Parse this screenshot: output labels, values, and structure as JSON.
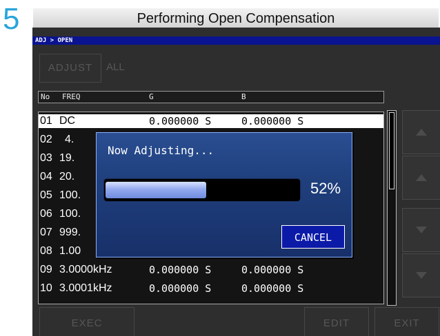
{
  "step_number": "5",
  "header": {
    "title": "Performing Open Compensation"
  },
  "breadcrumb": "ADJ > OPEN",
  "toolbar": {
    "adjust_label": "ADJUST",
    "all_label": "ALL"
  },
  "table": {
    "columns": [
      "No",
      "FREQ",
      "G",
      "B"
    ],
    "rows": [
      {
        "no": "01",
        "freq": "DC",
        "g": "0.000000 S",
        "b": "0.000000 S"
      },
      {
        "no": "02",
        "freq": "4.",
        "g": "",
        "b": ""
      },
      {
        "no": "03",
        "freq": "19.",
        "g": "",
        "b": ""
      },
      {
        "no": "04",
        "freq": "20.",
        "g": "",
        "b": ""
      },
      {
        "no": "05",
        "freq": "100.",
        "g": "",
        "b": ""
      },
      {
        "no": "06",
        "freq": "100.",
        "g": "",
        "b": ""
      },
      {
        "no": "07",
        "freq": "999.",
        "g": "",
        "b": ""
      },
      {
        "no": "08",
        "freq": "1.00",
        "g": "",
        "b": ""
      },
      {
        "no": "09",
        "freq": "3.0000kHz",
        "g": "0.000000 S",
        "b": "0.000000 S"
      },
      {
        "no": "10",
        "freq": "3.0001kHz",
        "g": "0.000000 S",
        "b": "0.000000 S"
      }
    ]
  },
  "bottom": {
    "exec_label": "EXEC",
    "edit_label": "EDIT",
    "exit_label": "EXIT"
  },
  "dialog": {
    "message": "Now Adjusting...",
    "progress": 52,
    "progress_label": "52%",
    "cancel_label": "CANCEL"
  },
  "side_buttons": [
    "page-up-icon",
    "up-arrow-icon",
    "down-arrow-icon",
    "page-down-icon"
  ],
  "colors": {
    "step_number": "#2aa5dc",
    "breadcrumb_bar": "#0a1390",
    "dialog_bg": "#1f3f7c",
    "cancel_button": "#0c1aa8"
  }
}
